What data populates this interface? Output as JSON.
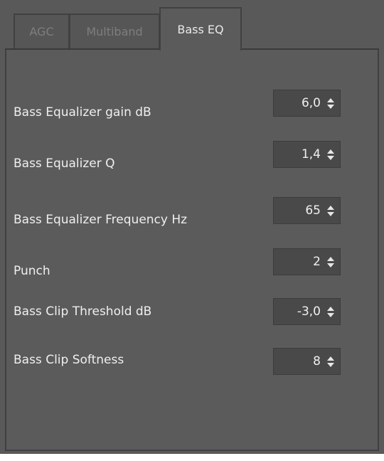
{
  "tabs": [
    {
      "label": "AGC",
      "active": false
    },
    {
      "label": "Multiband",
      "active": false
    },
    {
      "label": "Bass EQ",
      "active": true
    }
  ],
  "settings": [
    {
      "label": "Bass Equalizer gain dB",
      "value": "6,0"
    },
    {
      "label": "Bass Equalizer Q",
      "value": "1,4"
    },
    {
      "label": "Bass Equalizer Frequency Hz",
      "value": "65"
    },
    {
      "label": "Punch",
      "value": "2"
    },
    {
      "label": "Bass Clip Threshold dB",
      "value": "-3,0"
    },
    {
      "label": "Bass Clip Softness",
      "value": "8"
    }
  ],
  "colors": {
    "background": "#595959",
    "panel": "#5b5b5b",
    "text": "#efefef",
    "inactive_tab_text": "#7e7e7e",
    "spinbox": "#494949"
  },
  "icons": {
    "spin_up": "triangle-up-icon",
    "spin_down": "triangle-down-icon"
  }
}
